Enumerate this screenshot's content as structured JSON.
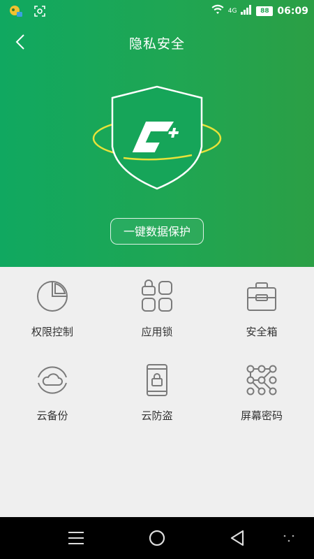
{
  "status_bar": {
    "network": "4G",
    "battery": "88",
    "time": "06:09"
  },
  "header": {
    "title": "隐私安全"
  },
  "hero": {
    "protect_button": "一键数据保护"
  },
  "features": [
    {
      "label": "权限控制",
      "icon": "pie-chart-icon"
    },
    {
      "label": "应用锁",
      "icon": "app-lock-icon"
    },
    {
      "label": "安全箱",
      "icon": "safe-box-icon"
    },
    {
      "label": "云备份",
      "icon": "cloud-backup-icon"
    },
    {
      "label": "云防盗",
      "icon": "phone-lock-icon"
    },
    {
      "label": "屏幕密码",
      "icon": "pattern-lock-icon"
    }
  ],
  "colors": {
    "hero_green": "#1fa653",
    "icon_gray": "#7a7a7a",
    "ring_yellow": "#e8e23a"
  }
}
